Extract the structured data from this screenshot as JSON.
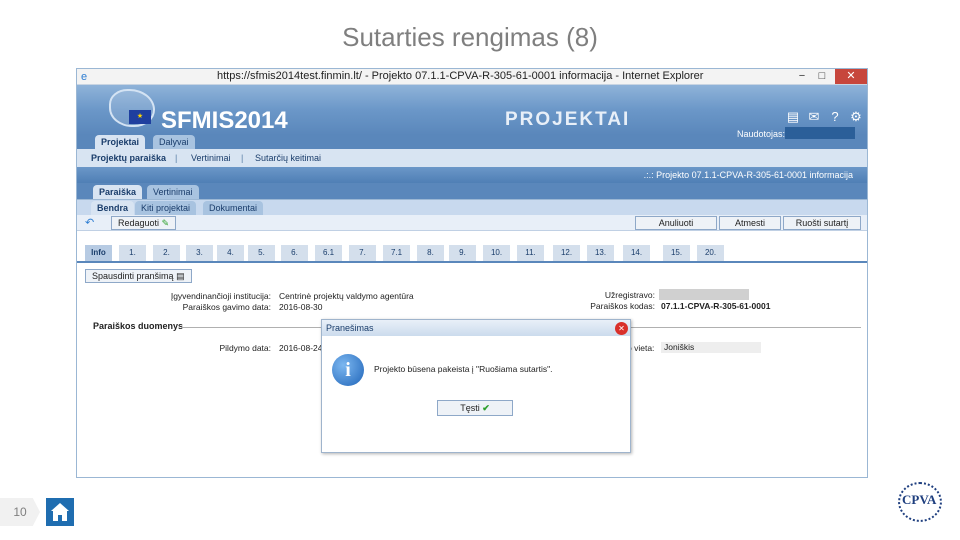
{
  "slide": {
    "title": "Sutarties rengimas (8)",
    "page_number": "10"
  },
  "browser": {
    "window_title": "https://sfmis2014test.finmin.lt/ - Projekto 07.1.1-CPVA-R-305-61-0001 informacija - Internet Explorer",
    "minimize": "−",
    "maximize": "□",
    "close": "✕"
  },
  "app": {
    "logo": "SFMIS2014",
    "section": "PROJEKTAI",
    "user_label": "Naudotojas:",
    "icons": [
      "windows-icon",
      "mail-icon",
      "help-icon",
      "settings-icon"
    ],
    "colors": {
      "banner": "#6b97c8",
      "accent": "#5a87bb",
      "dialog_close": "#d9302a"
    }
  },
  "top_tabs": [
    "Projektai",
    "Dalyvai"
  ],
  "subnav": [
    "Projektų paraiška",
    "Vertinimai",
    "Sutarčių keitimai"
  ],
  "info_title": ".:.: Projekto 07.1.1-CPVA-R-305-61-0001 informacija",
  "level2_tabs": [
    "Paraiška",
    "Vertinimai"
  ],
  "level3_tabs": [
    "Bendra",
    "Kiti projektai",
    "Dokumentai"
  ],
  "toolbar": {
    "edit": "Redaguoti",
    "cancel": "Anuliuoti",
    "reject": "Atmesti",
    "prepare": "Ruošti sutartį"
  },
  "number_tabs": [
    "Info",
    "1.",
    "2.",
    "3.",
    "4.",
    "5.",
    "6.",
    "6.1",
    "7.",
    "7.1",
    "8.",
    "9.",
    "10.",
    "11.",
    "12.",
    "13.",
    "14.",
    "15.",
    "20."
  ],
  "print_button": "Spausdinti pranšimą",
  "form": {
    "institution_label": "Įgyvendinančioji institucija:",
    "institution_value": "Centrinė projektų valdymo agentūra",
    "received_label": "Paraiškos gavimo data:",
    "received_value": "2016-08-30",
    "registered_label": "Užregistravo:",
    "code_label": "Paraiškos kodas:",
    "code_value": "07.1.1-CPVA-R-305-61-0001",
    "section_heading": "Paraiškos duomenys",
    "filled_label": "Pildymo data:",
    "filled_value": "2016-08-24",
    "place_label": "o vieta:",
    "place_value": "Joniškis"
  },
  "dialog": {
    "title": "Pranešimas",
    "message": "Projekto būsena pakeista į \"Ruošiama sutartis\".",
    "ok": "Tęsti"
  },
  "footer": {
    "logo_text": "CPVA"
  }
}
